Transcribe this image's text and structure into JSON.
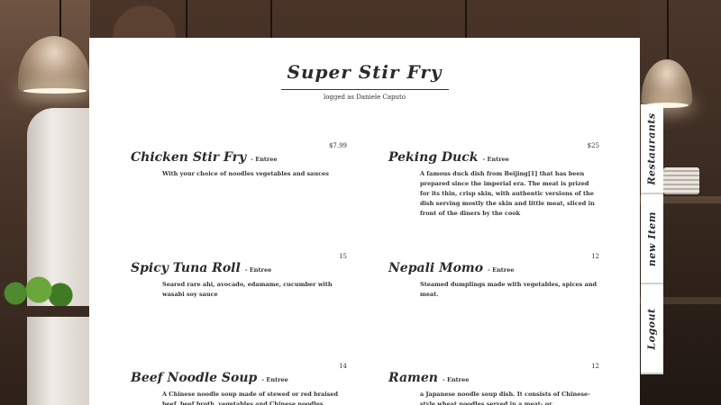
{
  "header": {
    "title": "Super Stir Fry",
    "logged_in": "logged as Daniele Caputo"
  },
  "menu": [
    {
      "name": "Chicken Stir Fry",
      "category": "- Entree",
      "price": "$7.99",
      "description": "With your choice of noodles vegetables and sauces"
    },
    {
      "name": "Peking Duck",
      "category": "- Entree",
      "price": "$25",
      "description": "A famous duck dish from Beijing[1] that has been prepared since the imperial era. The meat is prized for its thin, crisp skin, with authentic versions of the dish serving mostly the skin and little meat, sliced in front of the diners by the cook"
    },
    {
      "name": "Spicy Tuna Roll",
      "category": "- Entree",
      "price": "15",
      "description": "Seared rare ahi, avocado, edamame, cucumber with wasabi soy sauce"
    },
    {
      "name": "Nepali Momo",
      "category": "- Entree",
      "price": "12",
      "description": "Steamed dumplings made with vegetables, spices and meat."
    },
    {
      "name": "Beef Noodle Soup",
      "category": "- Entree",
      "price": "14",
      "description": "A Chinese noodle soup made of stewed or red braised beef, beef broth, vegetables and Chinese noodles."
    },
    {
      "name": "Ramen",
      "category": "- Entree",
      "price": "12",
      "description": "a Japanese noodle soup dish. It consists of Chinese-style wheat noodles served in a meat- or (occasionally) fish-based broth, often"
    }
  ],
  "side_nav": {
    "restaurants": "Restaurants",
    "new_item": "new Item",
    "logout": "Logout"
  }
}
